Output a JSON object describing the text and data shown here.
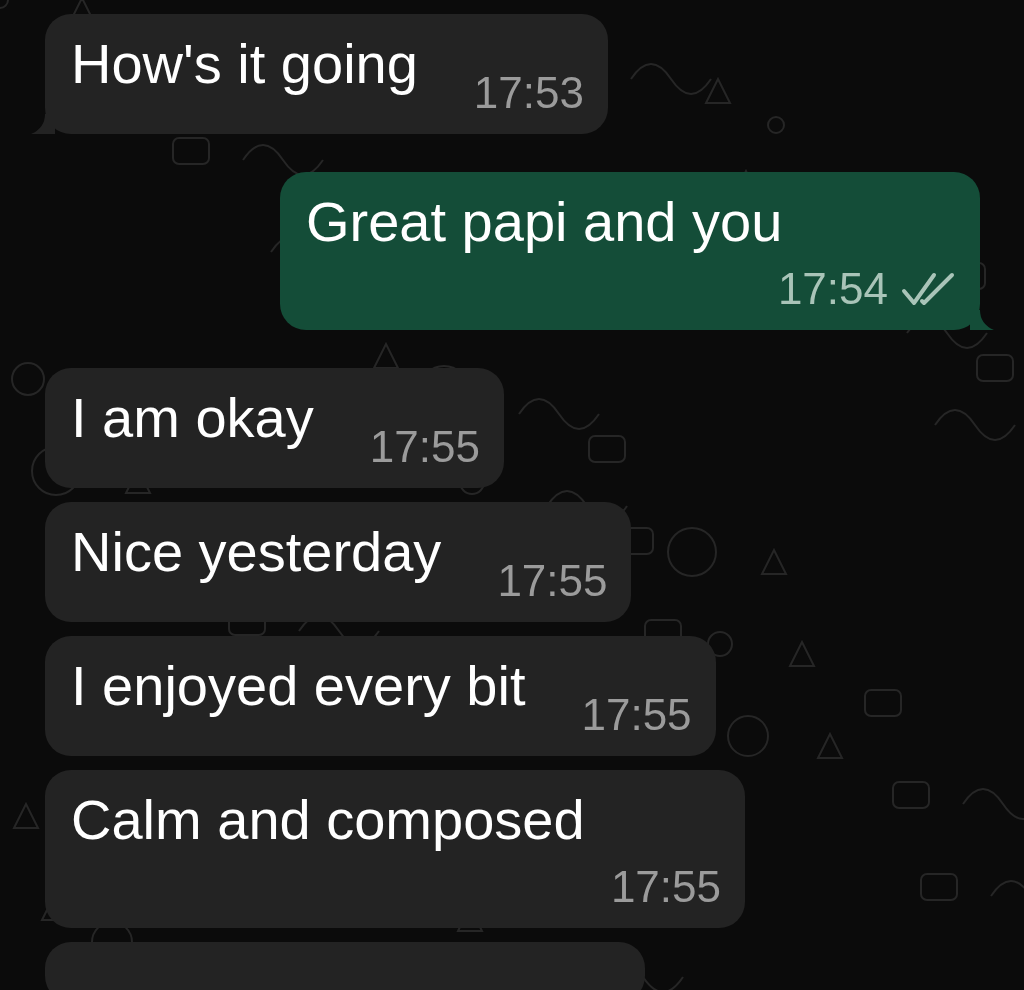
{
  "messages": [
    {
      "outgoing": false,
      "text": "How's it going",
      "time": "17:53",
      "tail": true
    },
    {
      "outgoing": true,
      "text": "Great papi and you",
      "time": "17:54",
      "tail": true,
      "read": false
    },
    {
      "outgoing": false,
      "text": "I am okay",
      "time": "17:55",
      "tail": false
    },
    {
      "outgoing": false,
      "text": "Nice yesterday",
      "time": "17:55",
      "tail": false
    },
    {
      "outgoing": false,
      "text": "I enjoyed every bit",
      "time": "17:55",
      "tail": false
    },
    {
      "outgoing": false,
      "text": "Calm and composed",
      "time": "17:55",
      "tail": false
    },
    {
      "outgoing": false,
      "tail": false
    }
  ]
}
